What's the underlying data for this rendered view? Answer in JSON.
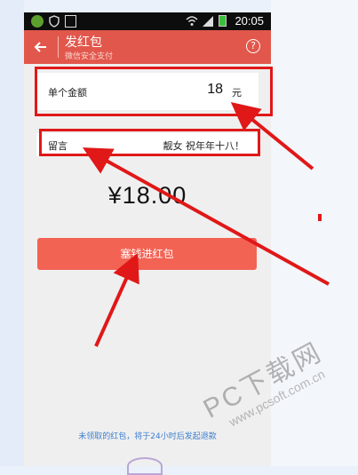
{
  "statusbar": {
    "time": "20:05"
  },
  "appbar": {
    "title": "发红包",
    "subtitle": "微信安全支付",
    "help": "?"
  },
  "amount_row": {
    "label": "单个金额",
    "value": "18",
    "unit": "元"
  },
  "message_row": {
    "label": "留言",
    "value": "靓女 祝年年十八！"
  },
  "total": "¥18.00",
  "submit_button": "塞钱进红包",
  "footer_note": "未领取的红包，将于24小时后发起退款",
  "watermark": {
    "main": "PC下载网",
    "sub": "www.pcsoft.com.cn"
  },
  "colors": {
    "accent": "#e2574c",
    "button": "#f26354",
    "annotation": "#e01818",
    "link": "#3d7fcf"
  }
}
